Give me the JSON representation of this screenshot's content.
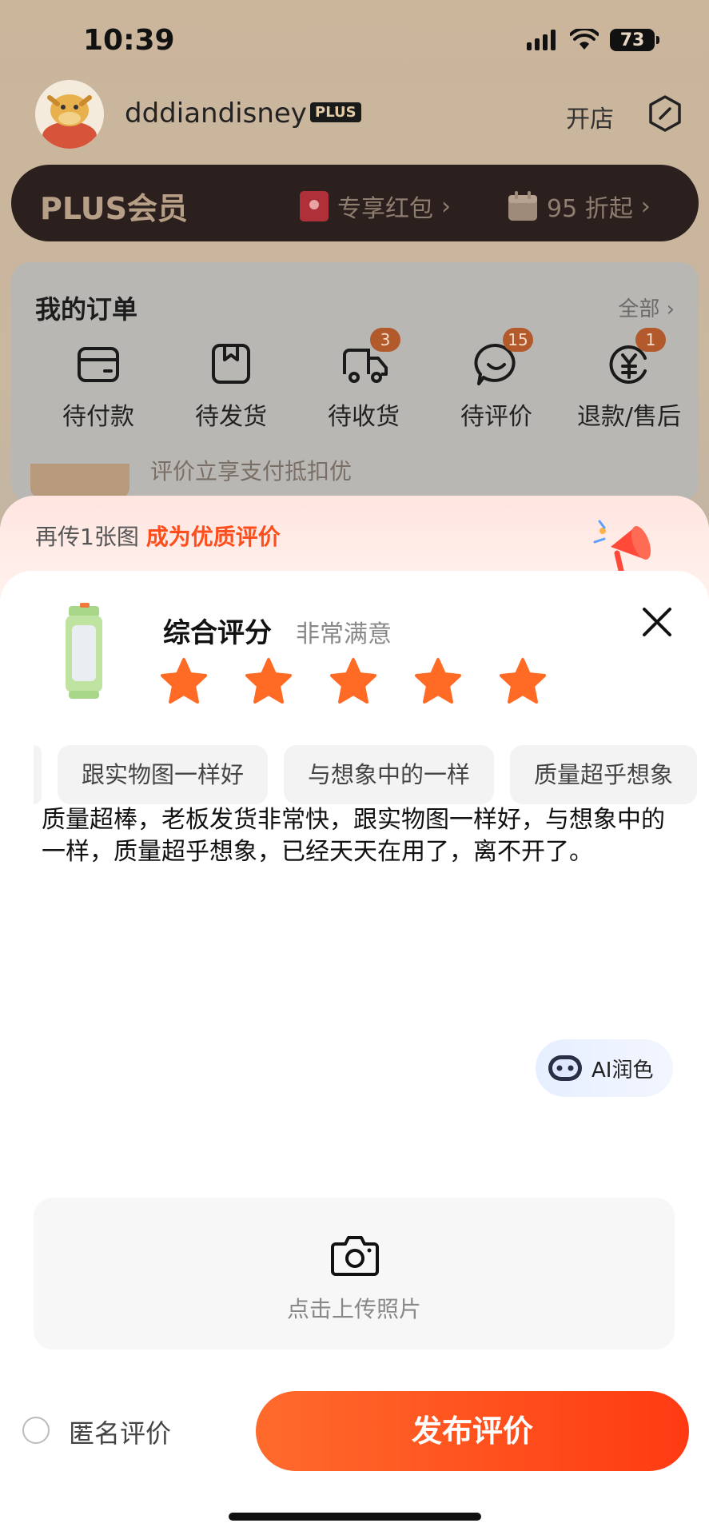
{
  "status": {
    "time": "10:39",
    "battery": "73"
  },
  "profile": {
    "username": "dddiandisney",
    "plus_badge": "PLUS",
    "open_store": "开店"
  },
  "plus_bar": {
    "title": "PLUS会员",
    "item1": "专享红包",
    "item2": "95 折起"
  },
  "orders": {
    "title": "我的订单",
    "all": "全部",
    "items": [
      {
        "label": "待付款",
        "icon": "wallet-icon"
      },
      {
        "label": "待发货",
        "icon": "package-icon"
      },
      {
        "label": "待收货",
        "icon": "truck-icon",
        "count": "3"
      },
      {
        "label": "待评价",
        "icon": "chat-smile-icon",
        "count": "15"
      },
      {
        "label": "退款/售后",
        "icon": "refund-icon",
        "count": "1"
      }
    ],
    "peek_text": "评价立享支付抵扣优"
  },
  "sheet": {
    "banner_prefix": "再传1张图 ",
    "banner_highlight": "成为优质评价",
    "rating_label": "综合评分",
    "rating_text": "非常满意",
    "stars": 5,
    "tags": [
      "跟实物图一样好",
      "与想象中的一样",
      "质量超乎想象"
    ],
    "review_text": "质量超棒，老板发货非常快，跟实物图一样好，与想象中的一样，质量超乎想象，已经天天在用了，离不开了。",
    "ai_button": "AI润色",
    "upload_label": "点击上传照片",
    "anonymous_label": "匿名评价",
    "publish_button": "发布评价"
  },
  "colors": {
    "accent": "#ff4d1c",
    "star": "#ff6a25"
  }
}
